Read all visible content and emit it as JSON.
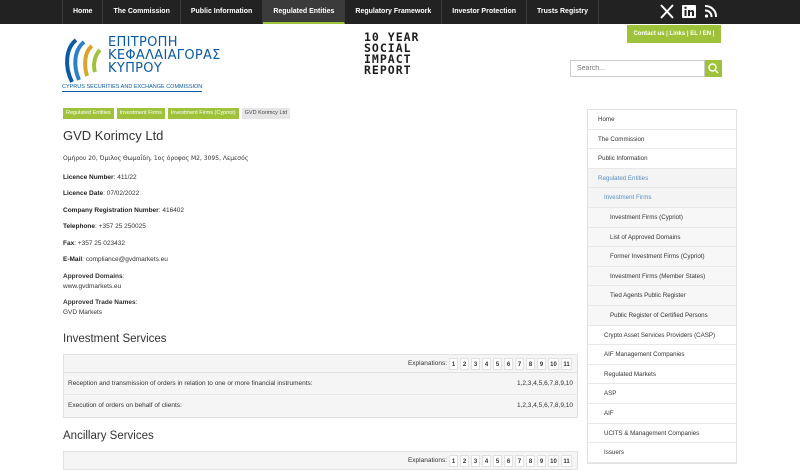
{
  "nav": {
    "items": [
      "Home",
      "The Commission",
      "Public Information",
      "Regulated Entities",
      "Regulatory Framework",
      "Investor Protection",
      "Trusts Registry"
    ],
    "active_index": 3,
    "social": [
      "x-icon",
      "linkedin-icon",
      "rss-icon"
    ]
  },
  "logo": {
    "lines": [
      "ΕΠΙΤΡΟΠΗ",
      "ΚΕΦΑΛΑΙΑΓΟΡΑΣ",
      "ΚΥΠΡΟΥ"
    ],
    "sub": "CYPRUS SECURITIES AND EXCHANGE COMMISSION"
  },
  "report_banner": [
    "10 YEAR",
    "SOCIAL",
    "IMPACT",
    "REPORT"
  ],
  "contact_bar": "Contact us  |  Links  |  EL / EN |",
  "search": {
    "placeholder": "Search..."
  },
  "breadcrumb": [
    "Regulated Entities",
    "Investment Firms",
    "Investment Firms (Cypriot)",
    "GVD Korimcy Ltd"
  ],
  "entity": {
    "name": "GVD Korimcy Ltd",
    "address": "Ομήρου 20, Όμιλος Θωμαΐδη, 1ος όροφος Μ2, 3095, Λεμεσός",
    "licence_number_label": "Licence Number",
    "licence_number": "411/22",
    "licence_date_label": "Licence Date",
    "licence_date": "07/02/2022",
    "company_reg_label": "Company Registration Number",
    "company_reg": "416402",
    "telephone_label": "Telephone",
    "telephone": "+357 25 250025",
    "fax_label": "Fax",
    "fax": "+357 25 023432",
    "email_label": "E-Mail",
    "email": "compliance@gvdmarkets.eu",
    "domains_label": "Approved Domains",
    "domain": "www.gvdmarkets.eu",
    "trade_names_label": "Approved Trade Names",
    "trade_name": "GVD Markets"
  },
  "investment_services": {
    "title": "Investment Services",
    "explanations_label": "Explanations:",
    "numbers": [
      "1",
      "2",
      "3",
      "4",
      "5",
      "6",
      "7",
      "8",
      "9",
      "10",
      "11"
    ],
    "rows": [
      {
        "service": "Reception and transmission of orders in relation to one or more financial instruments:",
        "explanations": "1,2,3,4,5,6,7,8,9,10"
      },
      {
        "service": "Execution of orders on behalf of clients:",
        "explanations": "1,2,3,4,5,6,7,8,9,10"
      }
    ]
  },
  "ancillary_services": {
    "title": "Ancillary Services",
    "explanations_label": "Explanations:",
    "numbers": [
      "1",
      "2",
      "3",
      "4",
      "5",
      "6",
      "7",
      "8",
      "9",
      "10",
      "11"
    ]
  },
  "sidebar": {
    "items": [
      {
        "label": "Home",
        "kind": "top"
      },
      {
        "label": "The Commission",
        "kind": "top"
      },
      {
        "label": "Public Information",
        "kind": "top"
      },
      {
        "label": "Regulated Entities",
        "kind": "active"
      },
      {
        "label": "Investment Firms",
        "kind": "sub-active"
      },
      {
        "label": "Investment Firms (Cypriot)",
        "kind": "sub"
      },
      {
        "label": "List of Approved Domains",
        "kind": "sub"
      },
      {
        "label": "Former Investment Firms (Cypriot)",
        "kind": "sub"
      },
      {
        "label": "Investment Firms (Member States)",
        "kind": "sub"
      },
      {
        "label": "Tied Agents Public Register",
        "kind": "sub"
      },
      {
        "label": "Public Register of Certified Persons",
        "kind": "sub"
      },
      {
        "label": "Crypto Asset Services Providers (CASP)",
        "kind": "l1"
      },
      {
        "label": "AIF Management Companies",
        "kind": "l1"
      },
      {
        "label": "Regulated Markets",
        "kind": "l1"
      },
      {
        "label": "ASP",
        "kind": "l1"
      },
      {
        "label": "AIF",
        "kind": "l1"
      },
      {
        "label": "UCITS & Management Companies",
        "kind": "l1"
      },
      {
        "label": "Issuers",
        "kind": "l1"
      }
    ]
  }
}
